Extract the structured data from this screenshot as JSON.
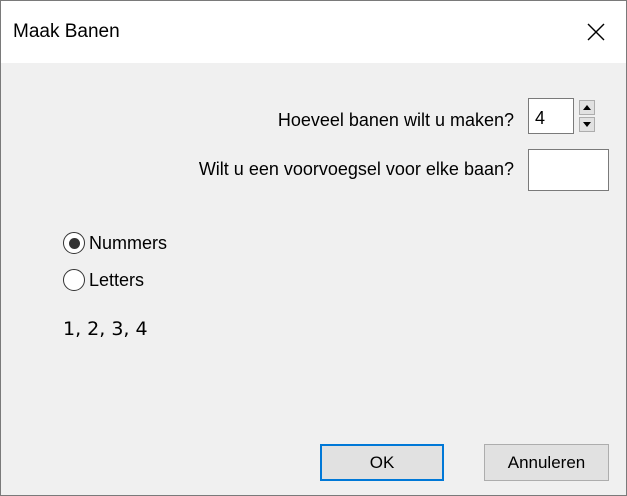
{
  "window": {
    "title": "Maak Banen"
  },
  "form": {
    "count_label": "Hoeveel banen wilt u maken?",
    "count_value": "4",
    "prefix_label": "Wilt u een voorvoegsel voor elke baan?",
    "prefix_value": ""
  },
  "options": {
    "numbers_label": "Nummers",
    "letters_label": "Letters",
    "selected": "Nummers"
  },
  "preview": {
    "text": "1, 2, 3, 4"
  },
  "buttons": {
    "ok_label": "OK",
    "cancel_label": "Annuleren"
  },
  "icons": {
    "close": "close-icon",
    "spin_up": "spin-up-icon",
    "spin_down": "spin-down-icon"
  },
  "colors": {
    "focus_border": "#0078d7",
    "background": "#f0f0f0"
  }
}
